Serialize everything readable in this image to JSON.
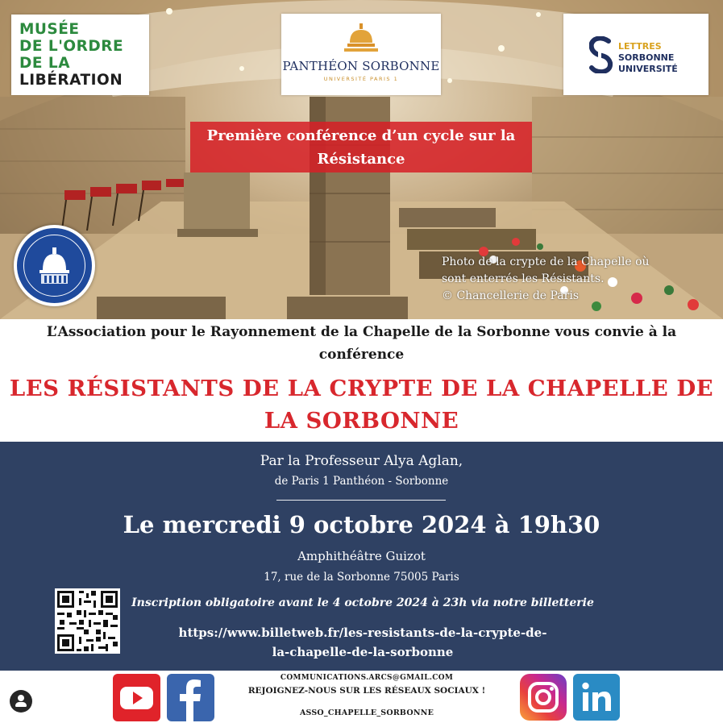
{
  "logos": {
    "musee": {
      "line1": "MUSÉE",
      "line2": "DE L'ORDRE",
      "line3": "DE LA",
      "line4": "LIBÉRATION"
    },
    "pantheon": {
      "name": "PANTHÉON SORBONNE",
      "sub": "UNIVERSITÉ PARIS 1"
    },
    "lettres": {
      "line1": "LETTRES",
      "line2": "SORBONNE",
      "line3": "UNIVERSITÉ"
    },
    "seal": {
      "name": "association-seal-logo"
    }
  },
  "banner": {
    "line1": "Première conférence d’un cycle sur la",
    "line2": "Résistance"
  },
  "photo_credit": {
    "line1": "Photo de la crypte de la Chapelle où",
    "line2": "sont enterrés les Résistants.",
    "line3": "© Chancellerie de Paris"
  },
  "invite": {
    "line1": "L’Association pour le Rayonnement de la Chapelle de la Sorbonne vous convie à la",
    "line2": "conférence"
  },
  "title": {
    "line1": "LES RÉSISTANTS DE LA CRYPTE DE LA CHAPELLE DE",
    "line2": "LA SORBONNE"
  },
  "details": {
    "speaker": "Par la Professeur Alya Aglan,",
    "affiliation": "de Paris 1 Panthéon - Sorbonne",
    "date": "Le mercredi 9 octobre 2024 à 19h30",
    "venue": "Amphithéâtre Guizot",
    "address": "17, rue de la Sorbonne 75005 Paris",
    "registration": "Inscription obligatoire avant le 4 octobre 2024 à 23h via notre billetterie",
    "link_line1": "https://www.billetweb.fr/les-resistants-de-la-crypte-de-",
    "link_line2": "la-chapelle-de-la-sorbonne"
  },
  "footer": {
    "email": "COMMUNICATIONS.ARCS@GMAIL.COM",
    "join": "REJOIGNEZ-NOUS SUR LES RÉSEAUX SOCIAUX !",
    "handle": "ASSO_CHAPELLE_SORBONNE",
    "socials": [
      "youtube-icon",
      "facebook-icon",
      "instagram-icon",
      "linkedin-icon"
    ]
  },
  "colors": {
    "banner_red": "#d62026",
    "title_red": "#d8272d",
    "navy": "#2f4163",
    "musee_green": "#2c8a3e"
  }
}
